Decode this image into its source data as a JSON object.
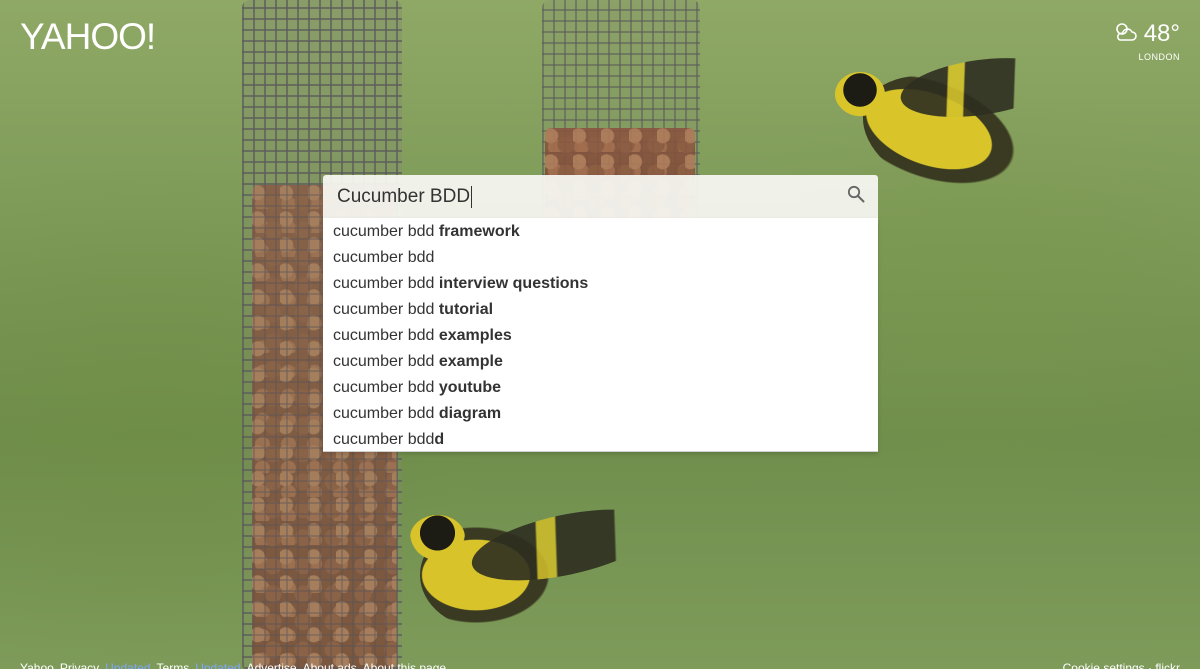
{
  "logo": {
    "text": "YAHOO!"
  },
  "weather": {
    "icon": "partly-cloudy-icon",
    "temperature": "48°",
    "location": "LONDON"
  },
  "search": {
    "query": "Cucumber BDD",
    "icon": "search-icon"
  },
  "suggestions": [
    {
      "prefix": "cucumber bdd ",
      "completion": "framework"
    },
    {
      "prefix": "cucumber bdd",
      "completion": ""
    },
    {
      "prefix": "cucumber bdd ",
      "completion": "interview questions"
    },
    {
      "prefix": "cucumber bdd ",
      "completion": "tutorial"
    },
    {
      "prefix": "cucumber bdd ",
      "completion": "examples"
    },
    {
      "prefix": "cucumber bdd ",
      "completion": "example"
    },
    {
      "prefix": "cucumber bdd ",
      "completion": "youtube"
    },
    {
      "prefix": "cucumber bdd ",
      "completion": "diagram"
    },
    {
      "prefix": "cucumber bdd",
      "completion": "d"
    }
  ],
  "footer": {
    "left_links": [
      "Yahoo",
      "Privacy",
      "Updated",
      "Terms",
      "Updated",
      "Advertise",
      "About ads",
      "About this page"
    ],
    "right_text": "Cookie settings · flickr"
  }
}
